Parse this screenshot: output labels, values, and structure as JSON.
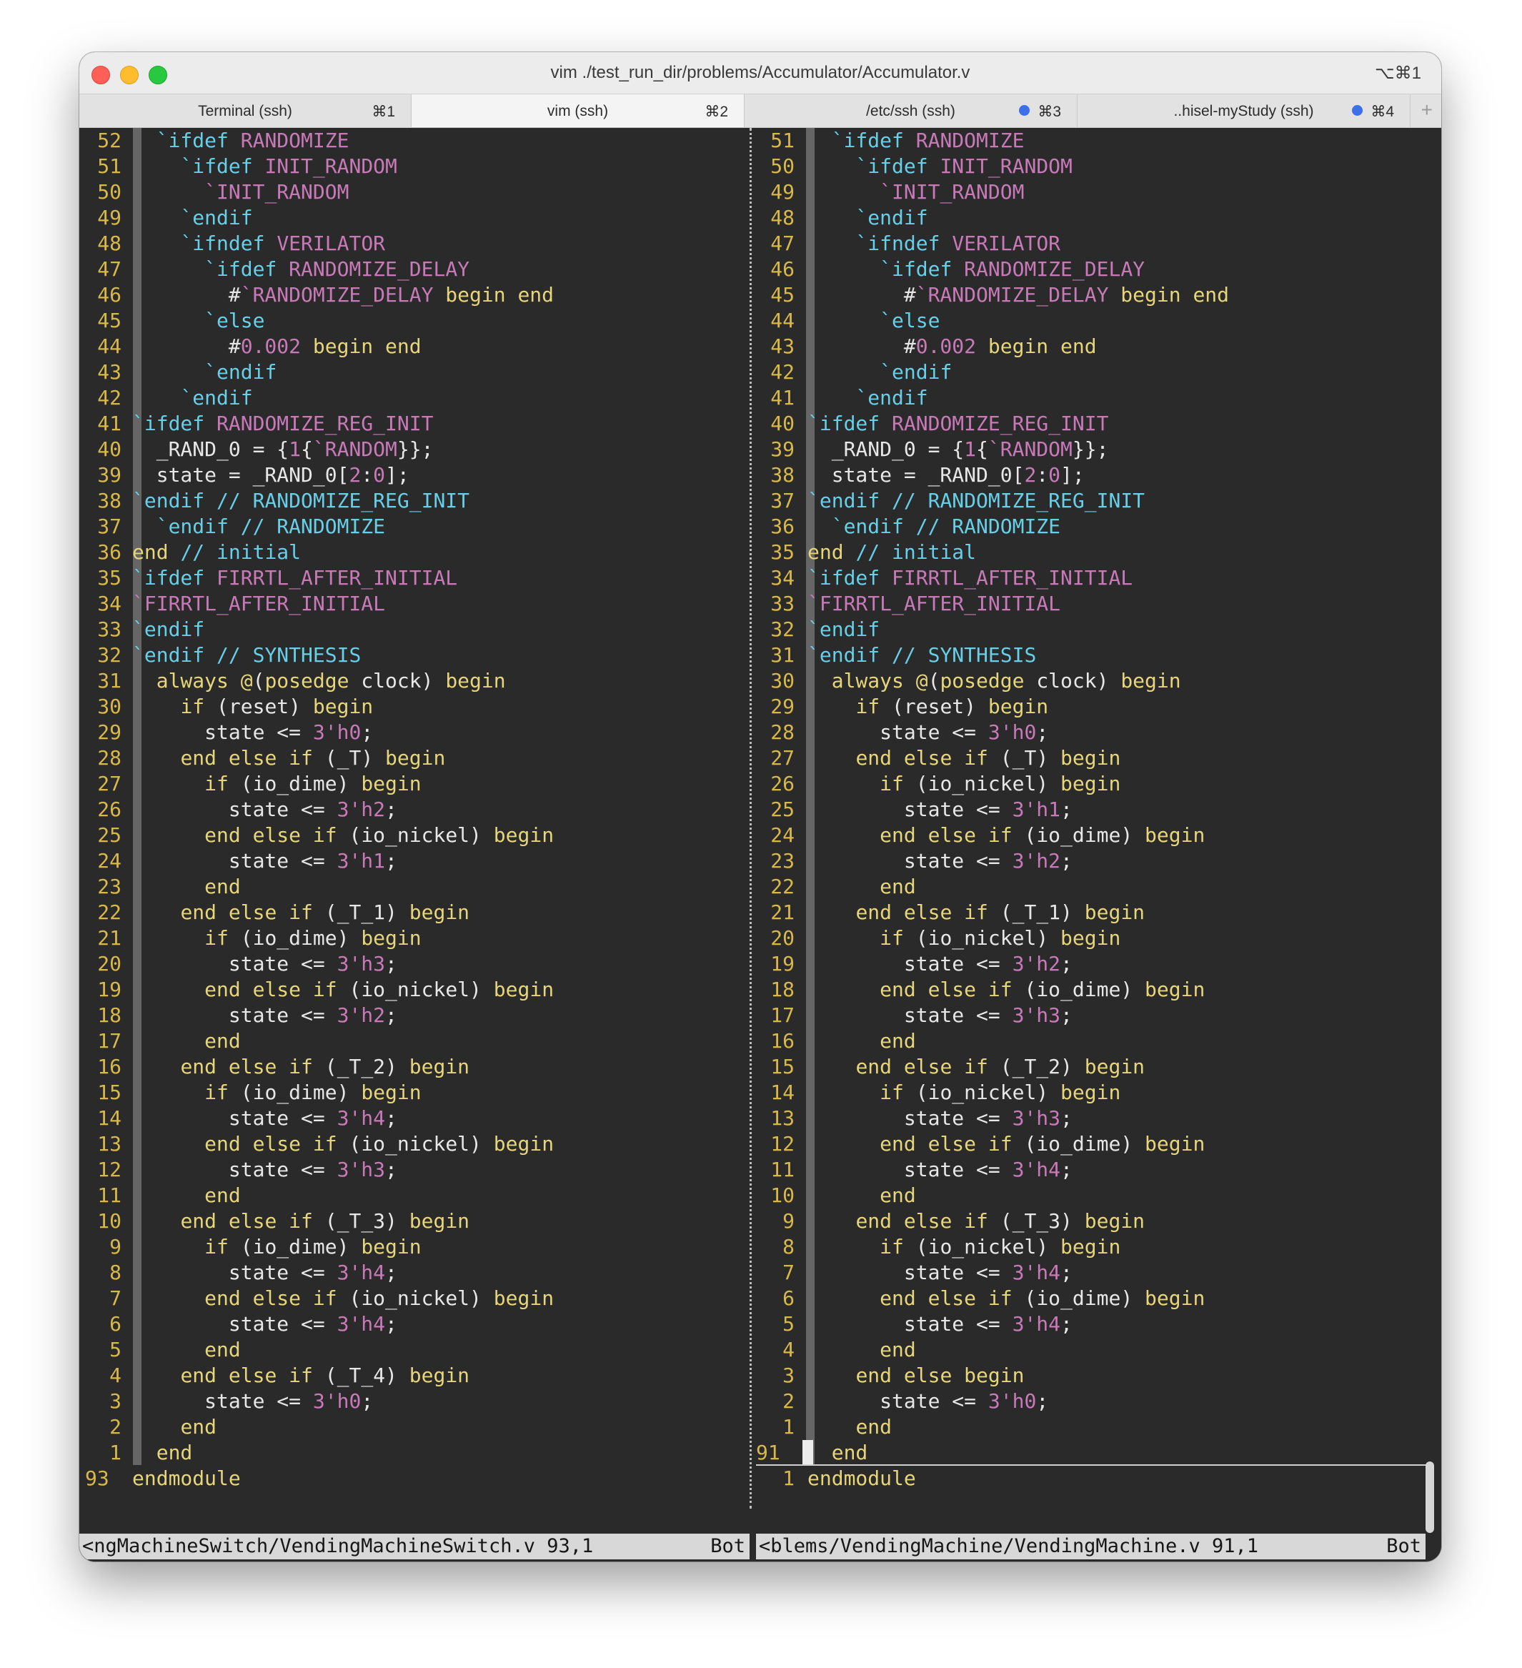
{
  "window": {
    "title": "vim ./test_run_dir/problems/Accumulator/Accumulator.v",
    "shortcut": "⌥⌘1"
  },
  "tabs": [
    {
      "label": "Terminal (ssh)",
      "shortcut": "⌘1",
      "active": false,
      "dot": false
    },
    {
      "label": "vim (ssh)",
      "shortcut": "⌘2",
      "active": true,
      "dot": false
    },
    {
      "label": "/etc/ssh (ssh)",
      "shortcut": "⌘3",
      "active": false,
      "dot": true
    },
    {
      "label": "..hisel-myStudy (ssh)",
      "shortcut": "⌘4",
      "active": false,
      "dot": true
    }
  ],
  "new_tab_label": "+",
  "left_pane": {
    "status_file": "<ngMachineSwitch/VendingMachineSwitch.v 93,1",
    "status_pos": "Bot",
    "last_line": {
      "num": "93",
      "code": "endmodule"
    },
    "lines": [
      {
        "num": "52",
        "code": "  `ifdef RANDOMIZE"
      },
      {
        "num": "51",
        "code": "    `ifdef INIT_RANDOM"
      },
      {
        "num": "50",
        "code": "      `INIT_RANDOM"
      },
      {
        "num": "49",
        "code": "    `endif"
      },
      {
        "num": "48",
        "code": "    `ifndef VERILATOR"
      },
      {
        "num": "47",
        "code": "      `ifdef RANDOMIZE_DELAY"
      },
      {
        "num": "46",
        "code": "        #`RANDOMIZE_DELAY begin end"
      },
      {
        "num": "45",
        "code": "      `else"
      },
      {
        "num": "44",
        "code": "        #0.002 begin end"
      },
      {
        "num": "43",
        "code": "      `endif"
      },
      {
        "num": "42",
        "code": "    `endif"
      },
      {
        "num": "41",
        "code": "`ifdef RANDOMIZE_REG_INIT"
      },
      {
        "num": "40",
        "code": "  _RAND_0 = {1{`RANDOM}};"
      },
      {
        "num": "39",
        "code": "  state = _RAND_0[2:0];"
      },
      {
        "num": "38",
        "code": "`endif // RANDOMIZE_REG_INIT"
      },
      {
        "num": "37",
        "code": "  `endif // RANDOMIZE"
      },
      {
        "num": "36",
        "code": "end // initial"
      },
      {
        "num": "35",
        "code": "`ifdef FIRRTL_AFTER_INITIAL"
      },
      {
        "num": "34",
        "code": "`FIRRTL_AFTER_INITIAL"
      },
      {
        "num": "33",
        "code": "`endif"
      },
      {
        "num": "32",
        "code": "`endif // SYNTHESIS"
      },
      {
        "num": "31",
        "code": "  always @(posedge clock) begin"
      },
      {
        "num": "30",
        "code": "    if (reset) begin"
      },
      {
        "num": "29",
        "code": "      state <= 3'h0;"
      },
      {
        "num": "28",
        "code": "    end else if (_T) begin"
      },
      {
        "num": "27",
        "code": "      if (io_dime) begin"
      },
      {
        "num": "26",
        "code": "        state <= 3'h2;"
      },
      {
        "num": "25",
        "code": "      end else if (io_nickel) begin"
      },
      {
        "num": "24",
        "code": "        state <= 3'h1;"
      },
      {
        "num": "23",
        "code": "      end"
      },
      {
        "num": "22",
        "code": "    end else if (_T_1) begin"
      },
      {
        "num": "21",
        "code": "      if (io_dime) begin"
      },
      {
        "num": "20",
        "code": "        state <= 3'h3;"
      },
      {
        "num": "19",
        "code": "      end else if (io_nickel) begin"
      },
      {
        "num": "18",
        "code": "        state <= 3'h2;"
      },
      {
        "num": "17",
        "code": "      end"
      },
      {
        "num": "16",
        "code": "    end else if (_T_2) begin"
      },
      {
        "num": "15",
        "code": "      if (io_dime) begin"
      },
      {
        "num": "14",
        "code": "        state <= 3'h4;"
      },
      {
        "num": "13",
        "code": "      end else if (io_nickel) begin"
      },
      {
        "num": "12",
        "code": "        state <= 3'h3;"
      },
      {
        "num": "11",
        "code": "      end"
      },
      {
        "num": "10",
        "code": "    end else if (_T_3) begin"
      },
      {
        "num": "9",
        "code": "      if (io_dime) begin"
      },
      {
        "num": "8",
        "code": "        state <= 3'h4;"
      },
      {
        "num": "7",
        "code": "      end else if (io_nickel) begin"
      },
      {
        "num": "6",
        "code": "        state <= 3'h4;"
      },
      {
        "num": "5",
        "code": "      end"
      },
      {
        "num": "4",
        "code": "    end else if (_T_4) begin"
      },
      {
        "num": "3",
        "code": "      state <= 3'h0;"
      },
      {
        "num": "2",
        "code": "    end"
      },
      {
        "num": "1",
        "code": "  end"
      }
    ]
  },
  "right_pane": {
    "status_file": "<blems/VendingMachine/VendingMachine.v 91,1",
    "status_pos": "Bot",
    "current_line_num": "91",
    "last_line": {
      "num": "1",
      "code": "endmodule"
    },
    "lines": [
      {
        "num": "51",
        "code": "  `ifdef RANDOMIZE"
      },
      {
        "num": "50",
        "code": "    `ifdef INIT_RANDOM"
      },
      {
        "num": "49",
        "code": "      `INIT_RANDOM"
      },
      {
        "num": "48",
        "code": "    `endif"
      },
      {
        "num": "47",
        "code": "    `ifndef VERILATOR"
      },
      {
        "num": "46",
        "code": "      `ifdef RANDOMIZE_DELAY"
      },
      {
        "num": "45",
        "code": "        #`RANDOMIZE_DELAY begin end"
      },
      {
        "num": "44",
        "code": "      `else"
      },
      {
        "num": "43",
        "code": "        #0.002 begin end"
      },
      {
        "num": "42",
        "code": "      `endif"
      },
      {
        "num": "41",
        "code": "    `endif"
      },
      {
        "num": "40",
        "code": "`ifdef RANDOMIZE_REG_INIT"
      },
      {
        "num": "39",
        "code": "  _RAND_0 = {1{`RANDOM}};"
      },
      {
        "num": "38",
        "code": "  state = _RAND_0[2:0];"
      },
      {
        "num": "37",
        "code": "`endif // RANDOMIZE_REG_INIT"
      },
      {
        "num": "36",
        "code": "  `endif // RANDOMIZE"
      },
      {
        "num": "35",
        "code": "end // initial"
      },
      {
        "num": "34",
        "code": "`ifdef FIRRTL_AFTER_INITIAL"
      },
      {
        "num": "33",
        "code": "`FIRRTL_AFTER_INITIAL"
      },
      {
        "num": "32",
        "code": "`endif"
      },
      {
        "num": "31",
        "code": "`endif // SYNTHESIS"
      },
      {
        "num": "30",
        "code": "  always @(posedge clock) begin"
      },
      {
        "num": "29",
        "code": "    if (reset) begin"
      },
      {
        "num": "28",
        "code": "      state <= 3'h0;"
      },
      {
        "num": "27",
        "code": "    end else if (_T) begin"
      },
      {
        "num": "26",
        "code": "      if (io_nickel) begin"
      },
      {
        "num": "25",
        "code": "        state <= 3'h1;"
      },
      {
        "num": "24",
        "code": "      end else if (io_dime) begin"
      },
      {
        "num": "23",
        "code": "        state <= 3'h2;"
      },
      {
        "num": "22",
        "code": "      end"
      },
      {
        "num": "21",
        "code": "    end else if (_T_1) begin"
      },
      {
        "num": "20",
        "code": "      if (io_nickel) begin"
      },
      {
        "num": "19",
        "code": "        state <= 3'h2;"
      },
      {
        "num": "18",
        "code": "      end else if (io_dime) begin"
      },
      {
        "num": "17",
        "code": "        state <= 3'h3;"
      },
      {
        "num": "16",
        "code": "      end"
      },
      {
        "num": "15",
        "code": "    end else if (_T_2) begin"
      },
      {
        "num": "14",
        "code": "      if (io_nickel) begin"
      },
      {
        "num": "13",
        "code": "        state <= 3'h3;"
      },
      {
        "num": "12",
        "code": "      end else if (io_dime) begin"
      },
      {
        "num": "11",
        "code": "        state <= 3'h4;"
      },
      {
        "num": "10",
        "code": "      end"
      },
      {
        "num": "9",
        "code": "    end else if (_T_3) begin"
      },
      {
        "num": "8",
        "code": "      if (io_nickel) begin"
      },
      {
        "num": "7",
        "code": "        state <= 3'h4;"
      },
      {
        "num": "6",
        "code": "      end else if (io_dime) begin"
      },
      {
        "num": "5",
        "code": "        state <= 3'h4;"
      },
      {
        "num": "4",
        "code": "      end"
      },
      {
        "num": "3",
        "code": "    end else begin"
      },
      {
        "num": "2",
        "code": "      state <= 3'h0;"
      },
      {
        "num": "1",
        "code": "    end"
      },
      {
        "num": "",
        "code": "  end"
      }
    ]
  },
  "colors": {
    "keyword": "#e6d57a",
    "preprocessor": "#67cfe7",
    "macro": "#c87ab8",
    "number": "#c87ab8",
    "line_number": "#d9b84a",
    "background": "#2a2a2a",
    "text": "#e7e7e7"
  }
}
